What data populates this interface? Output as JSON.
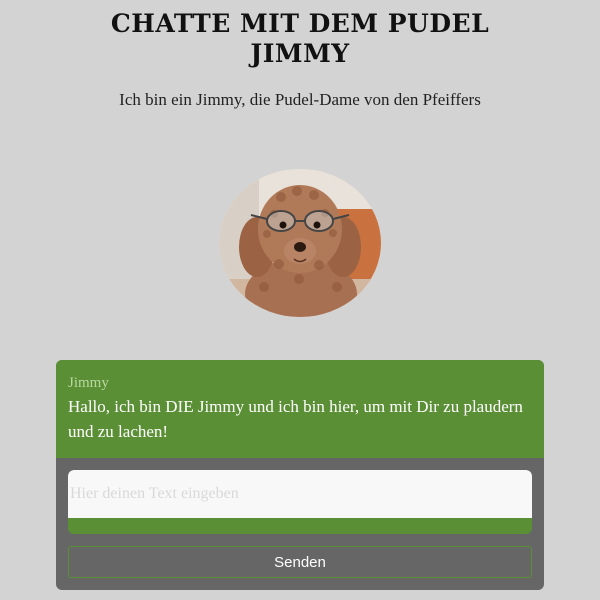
{
  "header": {
    "title": "CHATTE MIT DEM PUDEL JIMMY",
    "subtitle": "Ich bin ein Jimmy, die Pudel-Dame von den Pfeiffers"
  },
  "avatar": {
    "icon": "poodle-photo"
  },
  "chat": {
    "messages": [
      {
        "sender": "Jimmy",
        "text": "Hallo, ich bin DIE Jimmy und ich bin hier, um mit Dir zu plaudern und zu lachen!"
      }
    ],
    "input": {
      "value": "",
      "placeholder": "Hier deinen Text eingeben"
    },
    "send_label": "Senden"
  },
  "colors": {
    "background": "#d3d3d3",
    "accent_green": "#5a8f35",
    "panel_gray": "#666666"
  }
}
